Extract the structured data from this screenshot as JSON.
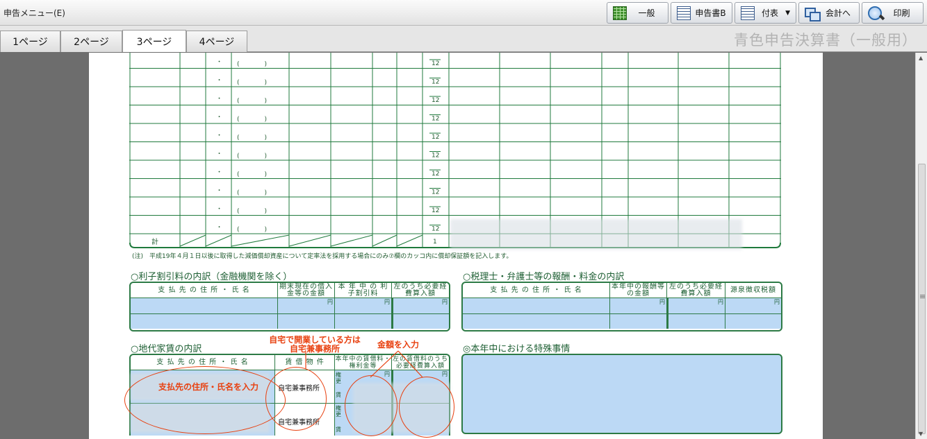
{
  "toolbar": {
    "menu_title": "申告メニュー(E)",
    "buttons": {
      "general": "一般",
      "return_b": "申告書B",
      "attachments": "付表",
      "to_accounting": "会計へ",
      "print": "印刷"
    },
    "icons": {
      "general": "table-icon",
      "return_b": "document-icon",
      "attachments": "document-icon",
      "to_accounting": "window-link-icon",
      "print": "magnifier-print-icon"
    }
  },
  "tabs": {
    "items": [
      {
        "label": "1ページ"
      },
      {
        "label": "2ページ"
      },
      {
        "label": "3ページ"
      },
      {
        "label": "4ページ"
      }
    ],
    "active_index": 2
  },
  "form_title": "青色申告決算書（一般用）",
  "depreciation": {
    "dot": "・",
    "paren": "(　　　　)",
    "months_denominator": "12",
    "total_label": "計",
    "total_denominator": "1"
  },
  "note": "(注)　平成19年４月１日以後に取得した減価償却資産について定率法を採用する場合にのみ⑦欄のカッコ内に償却保証額を記入します。",
  "interest": {
    "title": "○利子割引料の内訳（金融機関を除く）",
    "headers": [
      "支 払 先 の 住 所 ・ 氏 名",
      "期末現在の借入金等の金額",
      "本 年 中 の 利子割引料",
      "左のうち必要経費算入額"
    ],
    "yen": "円"
  },
  "tax_accountant": {
    "title": "○税理士・弁護士等の報酬・料金の内訳",
    "headers": [
      "支 払 先 の 住 所 ・ 氏 名",
      "本年中の報酬等の金額",
      "左のうち必要経費算入額",
      "源泉徴収税額"
    ],
    "yen": "円"
  },
  "rent": {
    "title": "○地代家賃の内訳",
    "headers": [
      "支 払 先 の 住 所 ・ 氏 名",
      "賃 借 物 件",
      "本年中の賃借料・権利金等",
      "左の賃借料のうち必要経費算入額"
    ],
    "property_1": "自宅兼事務所",
    "property_2": "自宅兼事務所",
    "kind_1": "権更",
    "kind_1b": "賃",
    "kind_2": "権更",
    "kind_2b": "賃",
    "yen": "円"
  },
  "special": {
    "title": "◎本年中における特殊事情"
  },
  "annotations": {
    "home_office": "自宅で開業している方は\n自宅兼事務所",
    "enter_amount": "金額を入力",
    "enter_payee": "支払先の住所・氏名を入力"
  },
  "colors": {
    "form_green": "#1f7a3c",
    "input_blue": "#bcd9f5",
    "annotation_red": "#e8400f",
    "title_gray": "#b3b3b3"
  }
}
